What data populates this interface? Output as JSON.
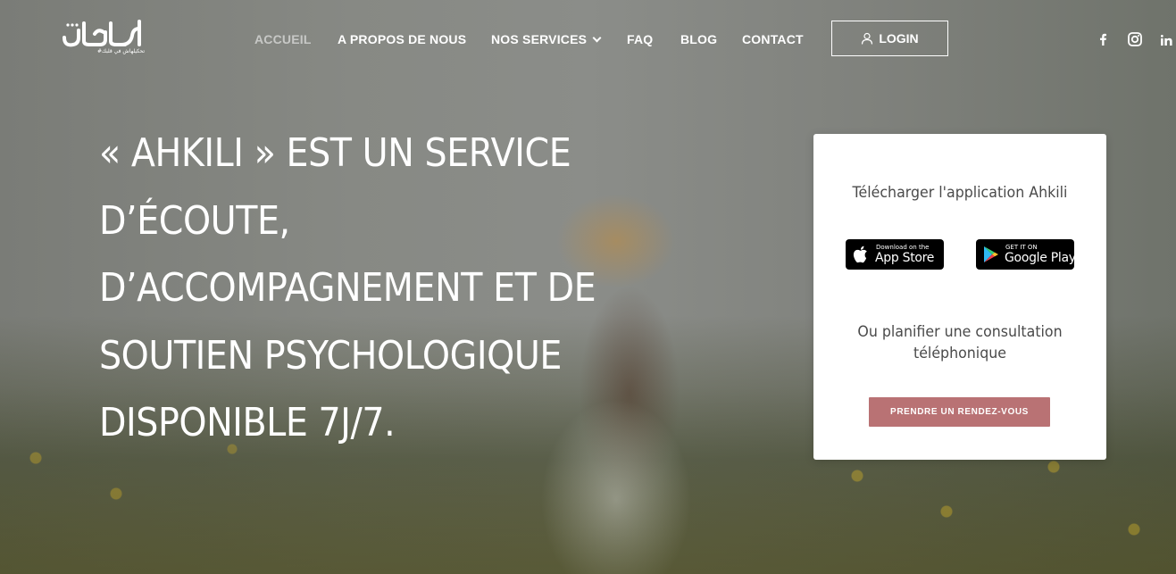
{
  "brand": {
    "logo_text": "احكيلي",
    "logo_tagline": "#تحكيلهاش في قلبك"
  },
  "nav": {
    "items": [
      {
        "label": "ACCUEIL",
        "active": true
      },
      {
        "label": "A PROPOS DE NOUS",
        "active": false
      },
      {
        "label": "NOS SERVICES",
        "active": false,
        "has_dropdown": true
      },
      {
        "label": "FAQ",
        "active": false
      },
      {
        "label": "BLOG",
        "active": false
      },
      {
        "label": "CONTACT",
        "active": false
      }
    ],
    "login_label": "LOGIN"
  },
  "social": [
    "facebook-icon",
    "instagram-icon",
    "linkedin-icon"
  ],
  "hero": {
    "headline_lines": [
      "« AHKILI » EST UN SERVICE",
      "D’ÉCOUTE,",
      "D’ACCOMPAGNEMENT ET DE",
      "SOUTIEN PSYCHOLOGIQUE",
      "DISPONIBLE 7J/7."
    ]
  },
  "card": {
    "title": "Télécharger l'application Ahkili",
    "app_store": {
      "small": "Download on the",
      "big": "App Store"
    },
    "google_play": {
      "small": "GET IT ON",
      "big": "Google Play"
    },
    "subtitle": "Ou planifier une consultation téléphonique",
    "button_label": "PRENDRE UN RENDEZ-VOUS"
  },
  "colors": {
    "accent": "#b97274",
    "nav_active": "#c7c8c6",
    "card_text": "#4a4a4a"
  }
}
